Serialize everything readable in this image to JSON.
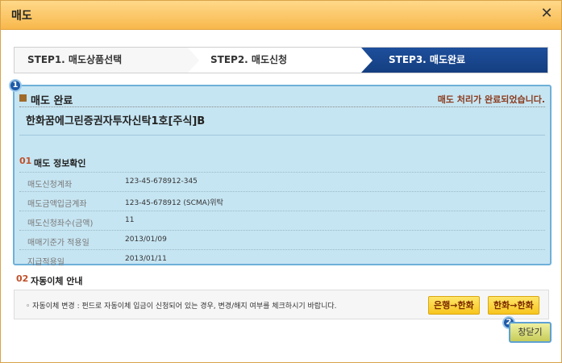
{
  "window": {
    "title": "매도",
    "close_icon": "close-icon"
  },
  "steps": [
    {
      "label": "STEP1. 매도상품선택"
    },
    {
      "label": "STEP2. 매도신청"
    },
    {
      "label": "STEP3. 매도완료"
    }
  ],
  "badges": {
    "b1": "1",
    "b2": "2"
  },
  "done": {
    "title": "매도 완료",
    "message": "매도 처리가 완료되었습니다.",
    "fund_name": "한화꿈에그린증권자투자신탁1호[주식]B"
  },
  "section1": {
    "num": "01",
    "title": "매도 정보확인"
  },
  "info_rows": [
    {
      "label": "매도신청계좌",
      "value": "123-45-678912-345"
    },
    {
      "label": "매도금액입금계좌",
      "value": "123-45-678912 (SCMA)위탁"
    },
    {
      "label": "매도신청좌수(금액)",
      "value": "11"
    },
    {
      "label": "매매기준가 적용일",
      "value": "2013/01/09"
    },
    {
      "label": "지급적용일",
      "value": "2013/01/11"
    }
  ],
  "section2": {
    "num": "02",
    "title": "자동이체 안내"
  },
  "auto": {
    "text": "◦ 자동이체 변경 : 펀드로 자동이체 입금이 신청되어 있는 경우, 변경/해지 여부를 체크하시기 바랍니다.",
    "btn_bank": "은행→한화",
    "btn_hanwha": "한화→한화"
  },
  "footer": {
    "close_label": "창닫기"
  },
  "colors": {
    "accent": "#1f5aa8",
    "title_bar": "#f8b84c",
    "done_bg": "#c6e5f2"
  }
}
